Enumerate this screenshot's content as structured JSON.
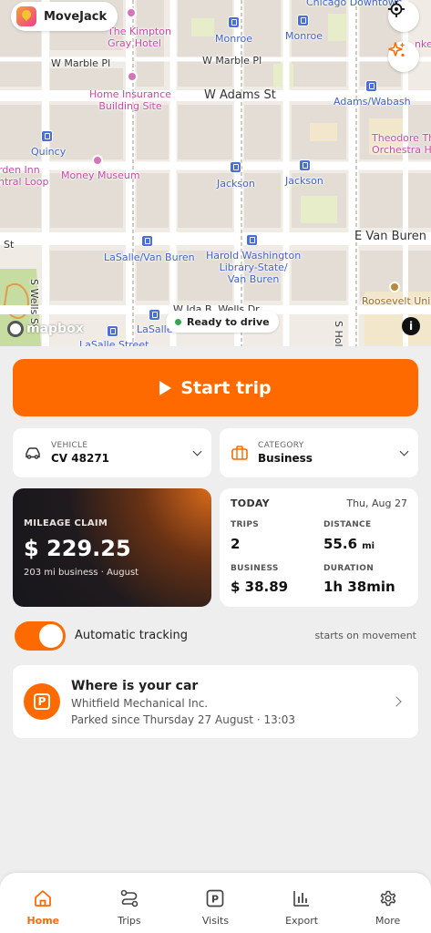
{
  "app": {
    "name": "MoveJack"
  },
  "map": {
    "labels": {
      "kimpton": "The Kimpton\nGray Hotel",
      "monroe1": "Monroe",
      "monroe2": "Monroe",
      "chicago_downtown": "Chicago Downtown",
      "marble1": "W Marble Pl",
      "marble2": "W Marble Pl",
      "home_insurance": "Home Insurance\nBuilding Site",
      "adams": "W Adams St",
      "adams_wabash": "Adams/Wabash",
      "theodore": "Theodore Th\nOrchestra H",
      "quincy": "Quincy",
      "garden_inn": "rden Inn\nntral Loop",
      "money_museum": "Money Museum",
      "jackson1": "Jackson",
      "jackson2": "Jackson",
      "st": "St",
      "van_buren": "E Van Buren St",
      "lasalle_van_buren": "LaSalle/Van Buren",
      "harold": "Harold Washington\nLibrary-State/\nVan Buren",
      "wells": "S Wells St",
      "wells_st": "W Ida B. Wells Dr",
      "lasalle": "LaSalle",
      "lasalle_street": "LaSalle Street",
      "roosevelt": "Roosevelt Univ",
      "s_hol": "S Hol",
      "partial_right": "nkec"
    },
    "mapbox": "mapbox",
    "status": "Ready to drive",
    "info": "i"
  },
  "actions": {
    "start_trip": "Start trip"
  },
  "vehicle": {
    "caption": "VEHICLE",
    "value": "CV 48271"
  },
  "category": {
    "caption": "CATEGORY",
    "value": "Business"
  },
  "claim": {
    "title": "MILEAGE CLAIM",
    "amount": "$ 229.25",
    "subtitle": "203 mi business · August"
  },
  "today": {
    "title": "TODAY",
    "date": "Thu, Aug 27",
    "trips_caption": "TRIPS",
    "trips_value": "2",
    "distance_caption": "DISTANCE",
    "distance_value": "55.6",
    "distance_unit": "mi",
    "business_caption": "BUSINESS",
    "business_value": "$ 38.89",
    "duration_caption": "DURATION",
    "duration_value": "1h 38min"
  },
  "tracking": {
    "label": "Automatic tracking",
    "hint": "starts on movement",
    "enabled": true
  },
  "car": {
    "title": "Where is your car",
    "place": "Whitfield Mechanical Inc.",
    "since": "Parked since Thursday 27 August · 13:03",
    "icon_letter": "P"
  },
  "nav": {
    "home": "Home",
    "trips": "Trips",
    "visits": "Visits",
    "export": "Export",
    "more": "More",
    "visits_letter": "P"
  },
  "colors": {
    "accent": "#ff6a00",
    "status_green": "#2fa84f",
    "transit_blue": "#4b6fd6",
    "poi_pink": "#d574b8"
  },
  "icons": {
    "locate": "crosshair-icon",
    "sparkle": "sparkle-icon",
    "vehicle": "car-icon",
    "category": "briefcase-icon",
    "parking": "parking-icon",
    "home": "home-icon",
    "trips": "route-icon",
    "visits": "parking-icon",
    "export": "bar-chart-icon",
    "more": "gear-icon"
  }
}
